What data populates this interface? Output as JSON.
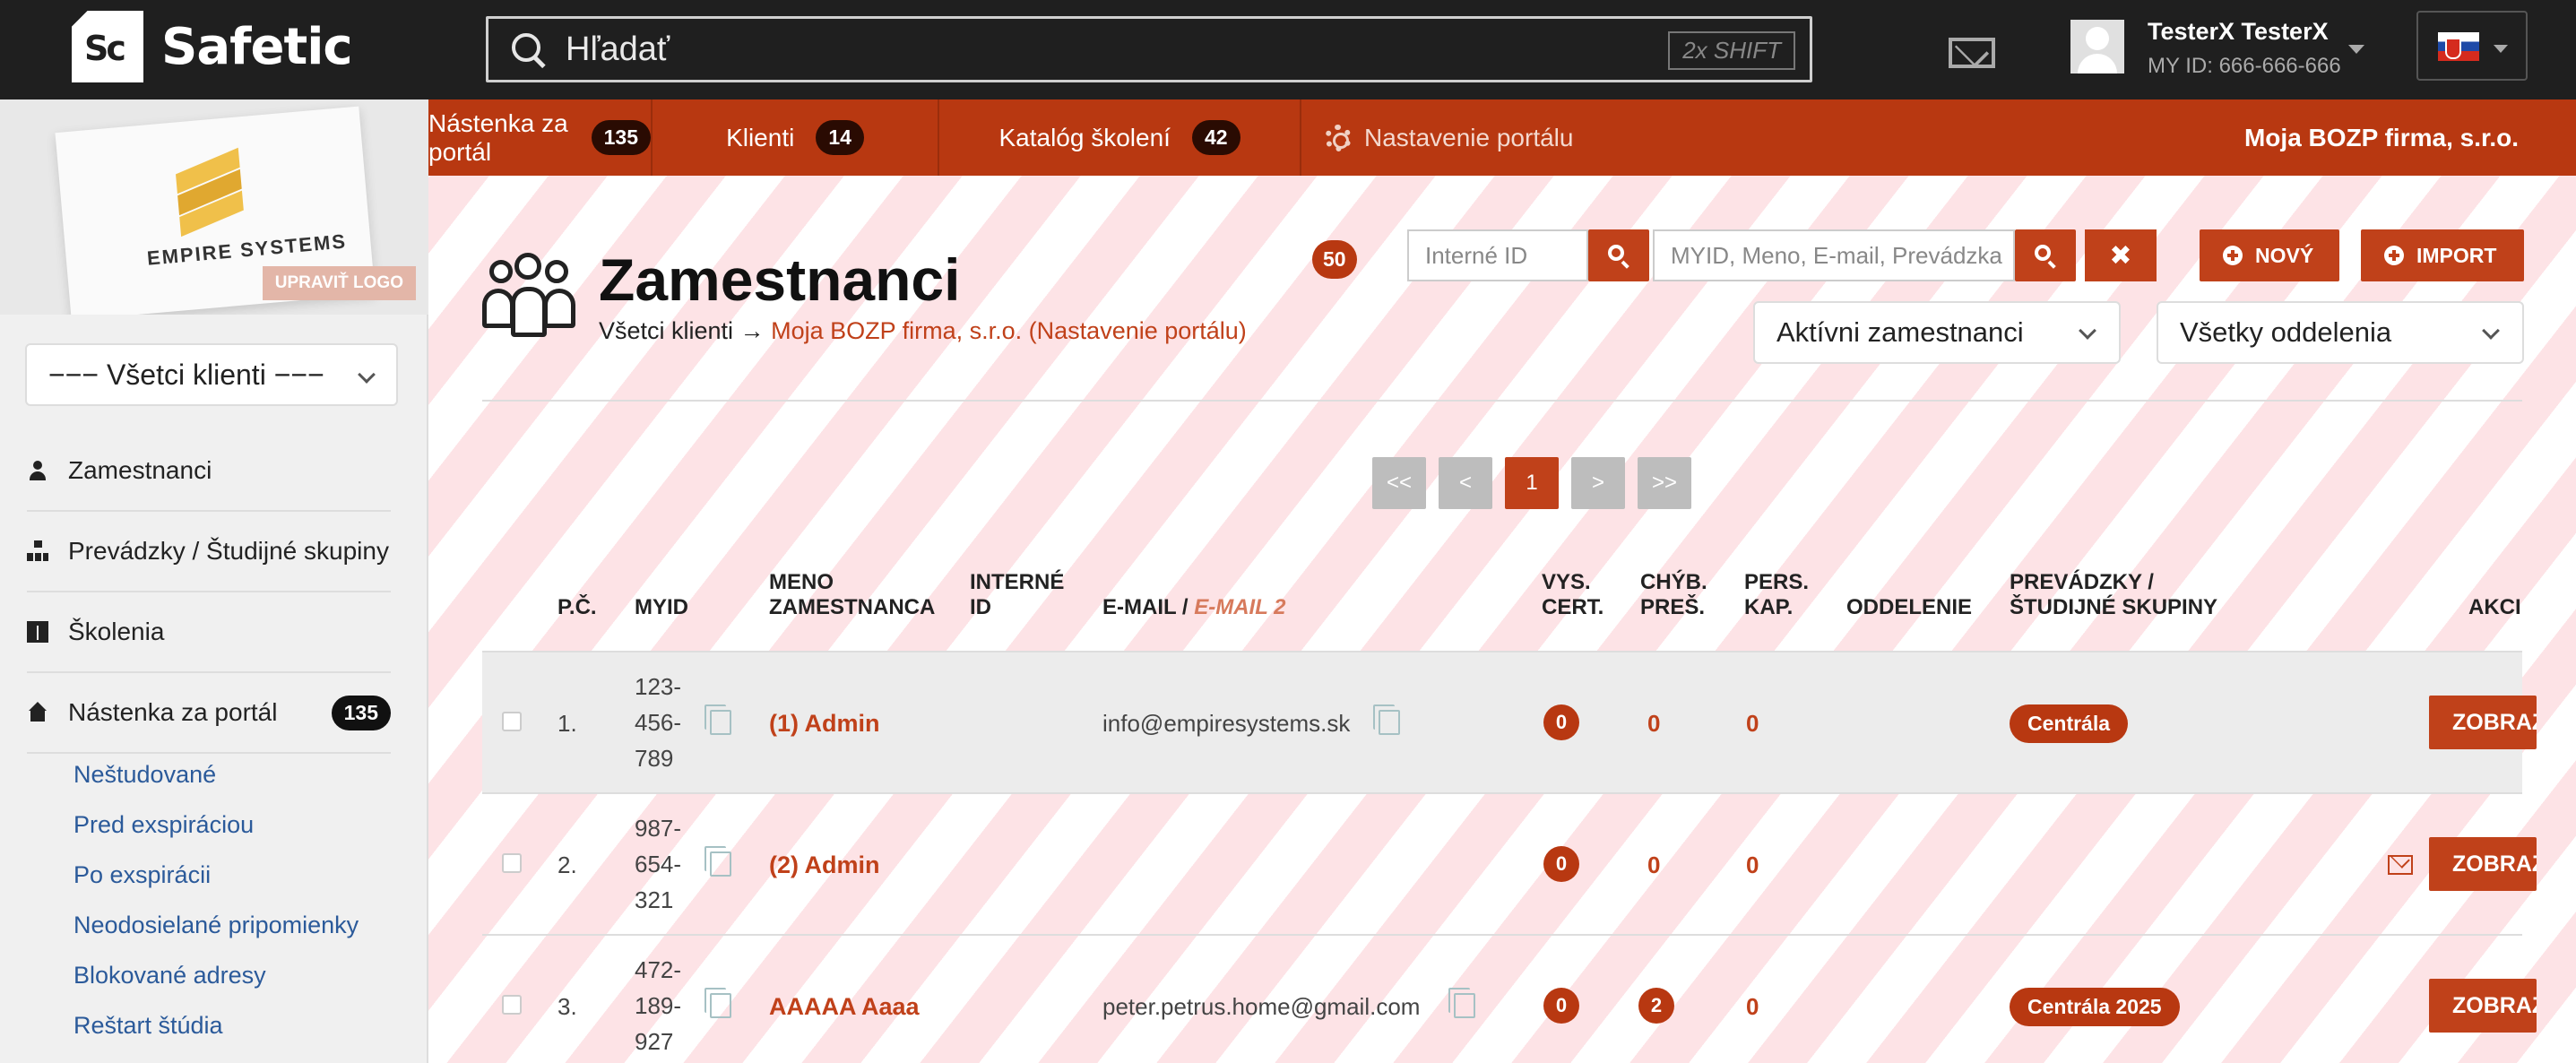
{
  "brand": {
    "name": "Safetic",
    "mark": "Sc"
  },
  "search": {
    "placeholder": "Hľadať",
    "shortcut": "2x SHIFT"
  },
  "user": {
    "name": "TesterX TesterX",
    "id_label": "MY ID: 666-666-666"
  },
  "nav": {
    "items": [
      {
        "label": "Nástenka za portál",
        "count": "135"
      },
      {
        "label": "Klienti",
        "count": "14"
      },
      {
        "label": "Katalóg školení",
        "count": "42"
      },
      {
        "label": "Nastavenie portálu"
      }
    ],
    "company": "Moja BOZP firma, s.r.o."
  },
  "sidebar": {
    "logo_text": "EMPIRE SYSTEMS",
    "edit_logo": "UPRAVIŤ LOGO",
    "client_select": "−−− Všetci klienti −−−",
    "items": [
      {
        "label": "Zamestnanci",
        "icon": "person-icon"
      },
      {
        "label": "Prevádzky / Študijné skupiny",
        "icon": "sitemap-icon"
      },
      {
        "label": "Školenia",
        "icon": "book-icon"
      },
      {
        "label": "Nástenka za portál",
        "icon": "home-icon",
        "count": "135"
      }
    ],
    "subitems": [
      "Neštudované",
      "Pred exspiráciou",
      "Po exspirácii",
      "Neodosielané pripomienky",
      "Blokované adresy",
      "Reštart štúdia"
    ]
  },
  "page": {
    "title": "Zamestnanci",
    "breadcrumb_root": "Všetci klienti",
    "breadcrumb_arrow": "→",
    "breadcrumb_link": "Moja BOZP firma, s.r.o. (Nastavenie portálu)",
    "total": "50"
  },
  "toolbar": {
    "internal_id_placeholder": "Interné ID",
    "multi_placeholder": "MYID, Meno, E-mail, Prevádzka",
    "clear": "✖",
    "new_label": "NOVÝ",
    "import_label": "IMPORT",
    "status_filter": "Aktívni zamestnanci",
    "department_filter": "Všetky oddelenia"
  },
  "pager": {
    "first": "<<",
    "prev": "<",
    "current": "1",
    "next": ">",
    "last": ">>"
  },
  "table": {
    "headers": {
      "pc": "P.Č.",
      "myid": "MYID",
      "name_1": "MENO",
      "name_2": "ZAMESTNANCA",
      "internal_1": "INTERNÉ",
      "internal_2": "ID",
      "email": "E-MAIL /",
      "email2": "E-MAIL 2",
      "cert_1": "VYS.",
      "cert_2": "CERT.",
      "err_1": "CHÝB.",
      "err_2": "PREŠ.",
      "cap_1": "PERS.",
      "cap_2": "KAP.",
      "dept": "ODDELENIE",
      "groups_1": "PREVÁDZKY /",
      "groups_2": "ŠTUDIJNÉ SKUPINY",
      "actions": "AKCIE"
    },
    "rows": [
      {
        "pc": "1.",
        "myid_1": "123-",
        "myid_2": "456-",
        "myid_3": "789",
        "name": "(1) Admin",
        "email": "info@empiresystems.sk",
        "cert": "0",
        "err": "0",
        "cap": "0",
        "group": "Centrála",
        "action": "ZOBRAZIŤ"
      },
      {
        "pc": "2.",
        "myid_1": "987-",
        "myid_2": "654-",
        "myid_3": "321",
        "name": "(2) Admin",
        "email": "",
        "cert": "0",
        "err": "0",
        "cap": "0",
        "group": "",
        "action": "ZOBRAZIŤ"
      },
      {
        "pc": "3.",
        "myid_1": "472-",
        "myid_2": "189-",
        "myid_3": "927",
        "name": "AAAAA Aaaa",
        "email": "peter.petrus.home@gmail.com",
        "cert": "0",
        "err": "2",
        "cap": "0",
        "group": "Centrála 2025",
        "action": "ZOBRAZIŤ"
      }
    ]
  }
}
